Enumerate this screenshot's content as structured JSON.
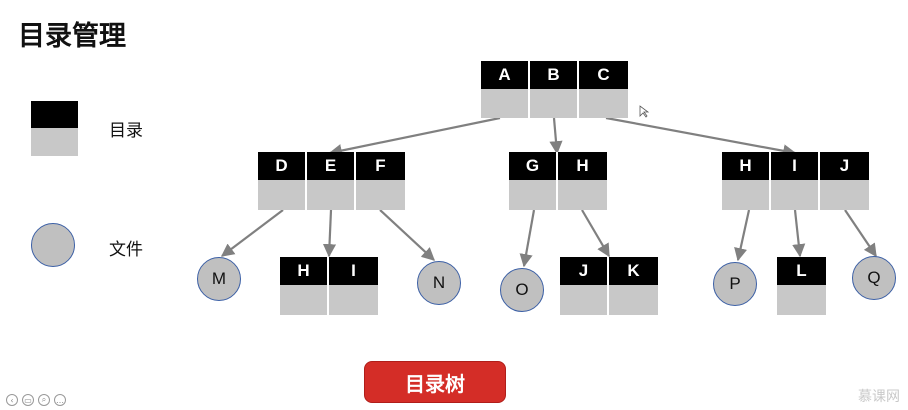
{
  "title": "目录管理",
  "legend": {
    "directory_label": "目录",
    "file_label": "文件"
  },
  "root": [
    "A",
    "B",
    "C"
  ],
  "level1": {
    "left": [
      "D",
      "E",
      "F"
    ],
    "middle": [
      "G",
      "H"
    ],
    "right": [
      "H",
      "I",
      "J"
    ]
  },
  "level2": {
    "dir_hi": [
      "H",
      "I"
    ],
    "dir_jk": [
      "J",
      "K"
    ],
    "dir_l": [
      "L"
    ],
    "files": [
      "M",
      "N",
      "O",
      "P",
      "Q"
    ]
  },
  "button_label": "目录树",
  "watermark": "慕课网",
  "colors": {
    "directory_header": "#000000",
    "directory_body": "#c8c8c8",
    "file_fill": "#c0c0c0",
    "file_border": "#3b5fa5",
    "button": "#d42d27",
    "edge": "#808080"
  }
}
